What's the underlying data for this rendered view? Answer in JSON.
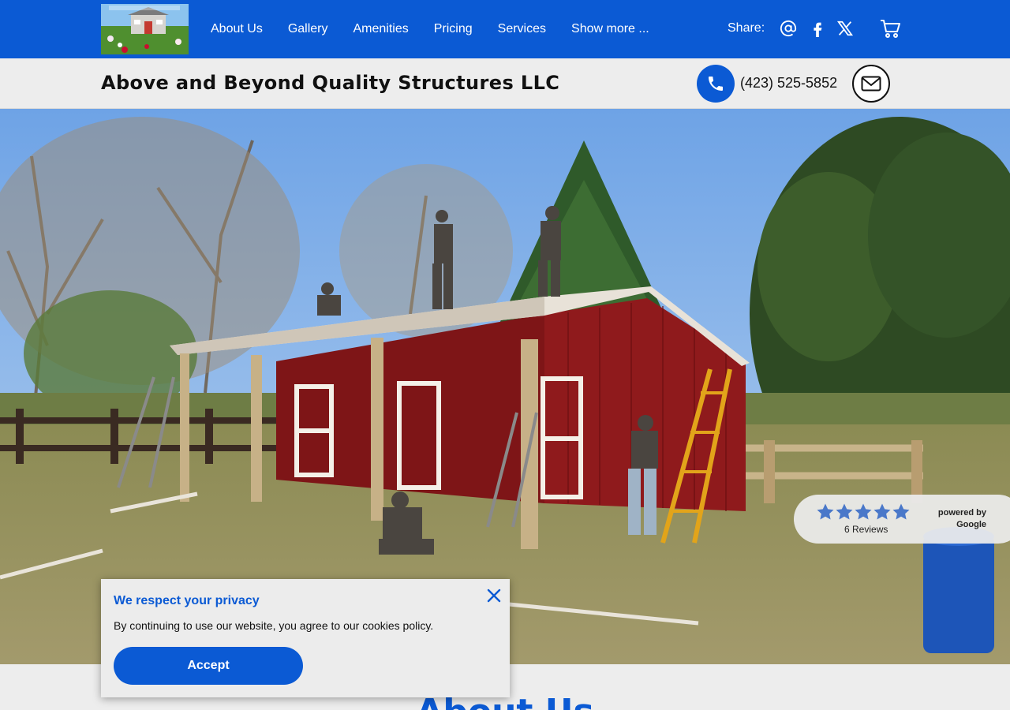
{
  "nav": {
    "logo_alt": "We Welcome Custom Designs",
    "links": [
      "About Us",
      "Gallery",
      "Amenities",
      "Pricing",
      "Services",
      "Show more ..."
    ],
    "share_label": "Share:",
    "share_icons": [
      "at-icon",
      "facebook-icon",
      "x-twitter-icon"
    ],
    "cart_icon": "cart-icon"
  },
  "header": {
    "site_title": "Above and Beyond Quality Structures LLC",
    "phone": "(423) 525-5852",
    "phone_icon": "phone-icon",
    "mail_icon": "mail-icon"
  },
  "reviews": {
    "rating": 5,
    "max_rating": 5,
    "count_label": "6 Reviews",
    "powered_by": "powered by",
    "provider": "Google"
  },
  "cookie_banner": {
    "title": "We respect your privacy",
    "text": "By continuing to use our website, you agree to our cookies policy.",
    "accept_label": "Accept"
  },
  "section": {
    "heading": "About Us"
  },
  "colors": {
    "brand_blue": "#0b5ad4",
    "star_blue": "#4a78c9",
    "barn_red": "#8f1a1c"
  }
}
